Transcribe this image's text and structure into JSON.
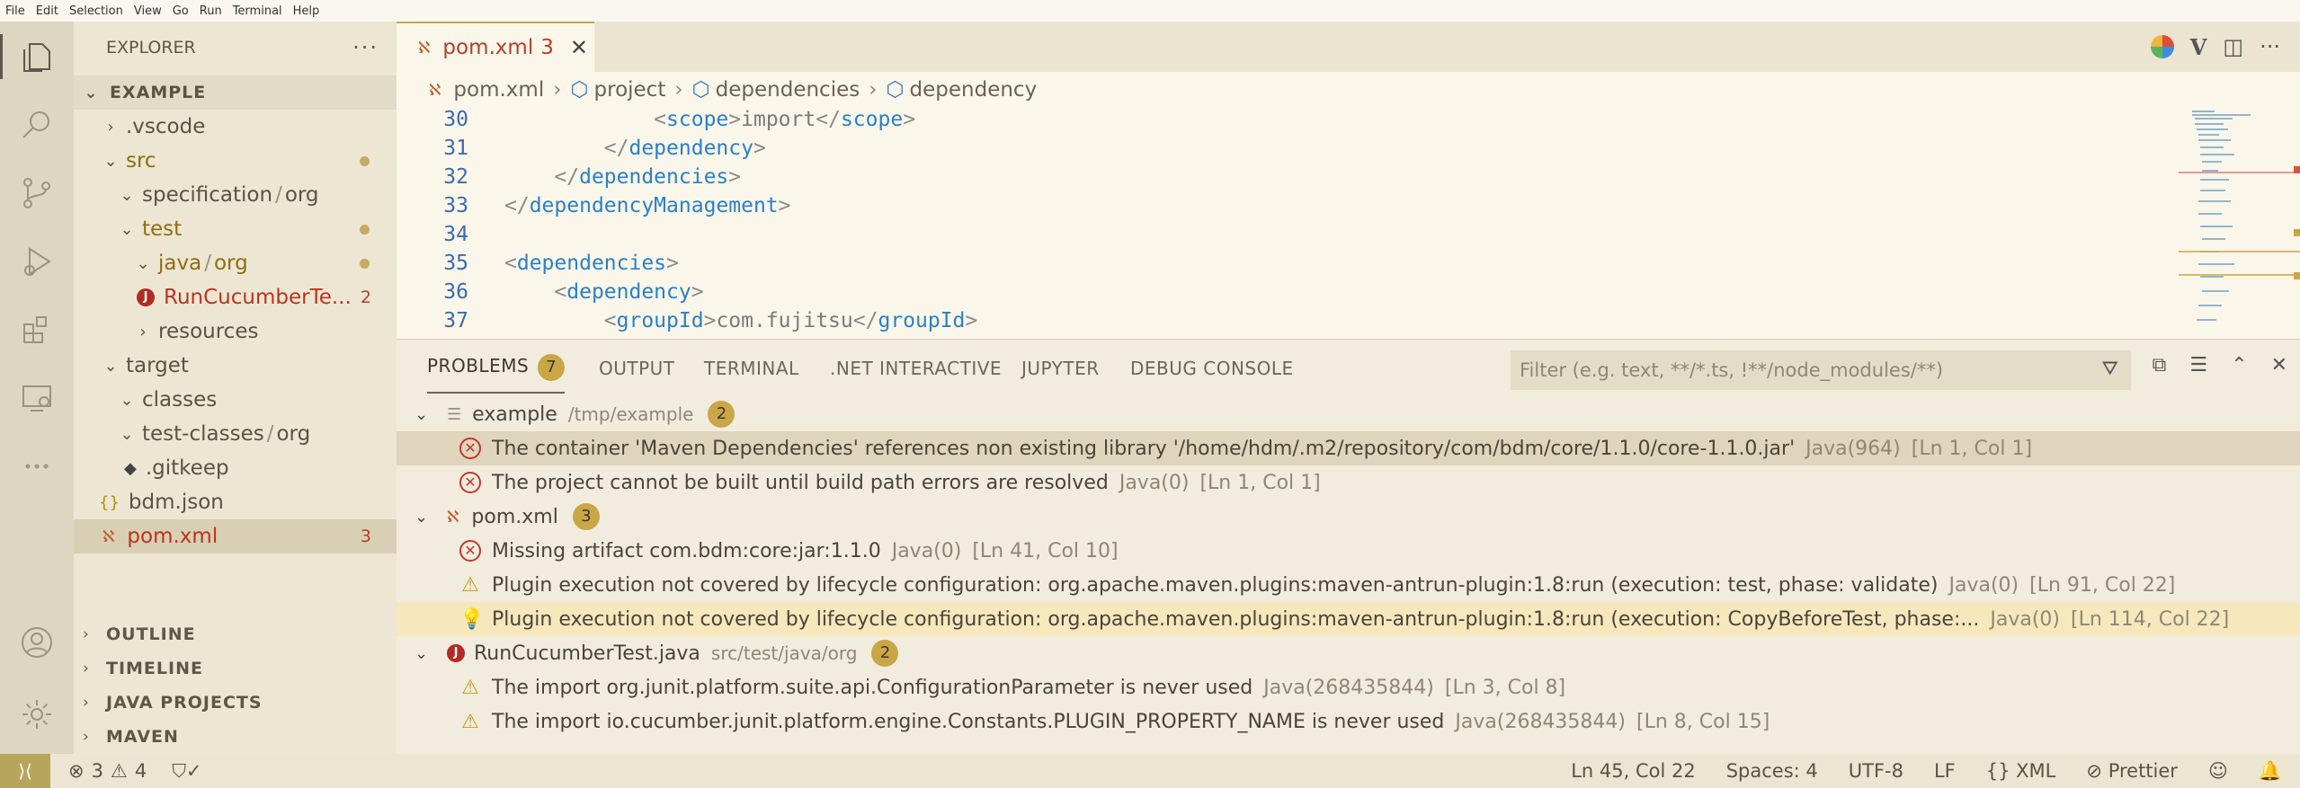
{
  "menu": [
    "File",
    "Edit",
    "Selection",
    "View",
    "Go",
    "Run",
    "Terminal",
    "Help"
  ],
  "explorer": {
    "title": "EXPLORER",
    "more": "···",
    "root": "EXAMPLE",
    "items": [
      {
        "label": ".vscode",
        "chev": "›",
        "indent": 1
      },
      {
        "label": "src",
        "chev": "⌄",
        "indent": 1
      },
      {
        "label": "specification",
        "label2": "org",
        "chev": "⌄",
        "indent": 2
      },
      {
        "label": "test",
        "chev": "⌄",
        "indent": 2
      },
      {
        "label": "java",
        "label2": "org",
        "chev": "⌄",
        "indent": 3
      },
      {
        "label": "RunCucumberTe...",
        "badge": "2",
        "indent": 3
      },
      {
        "label": "resources",
        "chev": "›",
        "indent": 3
      },
      {
        "label": "target",
        "chev": "⌄",
        "indent": 1
      },
      {
        "label": "classes",
        "chev": "⌄",
        "indent": 2
      },
      {
        "label": "test-classes",
        "label2": "org",
        "chev": "⌄",
        "indent": 2
      },
      {
        "label": ".gitkeep",
        "indent": 2
      },
      {
        "label": "bdm.json",
        "indent": 1
      },
      {
        "label": "pom.xml",
        "badge": "3",
        "indent": 1
      }
    ],
    "sections": [
      "OUTLINE",
      "TIMELINE",
      "JAVA PROJECTS",
      "MAVEN"
    ]
  },
  "editor": {
    "tab": {
      "label": "pom.xml",
      "count": "3"
    },
    "breadcrumb": [
      "pom.xml",
      "project",
      "dependencies",
      "dependency"
    ],
    "lines": [
      {
        "n": "30",
        "text": "            <scope>import</scope>"
      },
      {
        "n": "31",
        "text": "        </dependency>"
      },
      {
        "n": "32",
        "text": "    </dependencies>"
      },
      {
        "n": "33",
        "text": "</dependencyManagement>"
      },
      {
        "n": "34",
        "text": ""
      },
      {
        "n": "35",
        "text": "<dependencies>"
      },
      {
        "n": "36",
        "text": "    <dependency>"
      },
      {
        "n": "37",
        "text": "        <groupId>com.fujitsu</groupId>"
      }
    ]
  },
  "panel": {
    "tabs": [
      "PROBLEMS",
      "OUTPUT",
      "TERMINAL",
      ".NET INTERACTIVE",
      "JUPYTER",
      "DEBUG CONSOLE"
    ],
    "problems_count": "7",
    "filter_placeholder": "Filter (e.g. text, **/*.ts, !**/node_modules/**)",
    "groups": [
      {
        "name": "example",
        "path": "/tmp/example",
        "count": "2"
      },
      {
        "name": "pom.xml",
        "path": "",
        "count": "3"
      },
      {
        "name": "RunCucumberTest.java",
        "path": "src/test/java/org",
        "count": "2"
      }
    ],
    "problems": [
      {
        "msg": "The container 'Maven Dependencies' references non existing library '/home/hdm/.m2/repository/com/bdm/core/1.1.0/core-1.1.0.jar'",
        "src": "Java(964)",
        "loc": "[Ln 1, Col 1]"
      },
      {
        "msg": "The project cannot be built until build path errors are resolved",
        "src": "Java(0)",
        "loc": "[Ln 1, Col 1]"
      },
      {
        "msg": "Missing artifact com.bdm:core:jar:1.1.0",
        "src": "Java(0)",
        "loc": "[Ln 41, Col 10]"
      },
      {
        "msg": "Plugin execution not covered by lifecycle configuration: org.apache.maven.plugins:maven-antrun-plugin:1.8:run (execution: test, phase: validate)",
        "src": "Java(0)",
        "loc": "[Ln 91, Col 22]"
      },
      {
        "msg": "Plugin execution not covered by lifecycle configuration: org.apache.maven.plugins:maven-antrun-plugin:1.8:run (execution: CopyBeforeTest, phase:...",
        "src": "Java(0)",
        "loc": "[Ln 114, Col 22]"
      },
      {
        "msg": "The import org.junit.platform.suite.api.ConfigurationParameter is never used",
        "src": "Java(268435844)",
        "loc": "[Ln 3, Col 8]"
      },
      {
        "msg": "The import io.cucumber.junit.platform.engine.Constants.PLUGIN_PROPERTY_NAME is never used",
        "src": "Java(268435844)",
        "loc": "[Ln 8, Col 15]"
      }
    ]
  },
  "status": {
    "errors": "3",
    "warnings": "4",
    "position": "Ln 45, Col 22",
    "spaces": "Spaces: 4",
    "encoding": "UTF-8",
    "eol": "LF",
    "lang": "XML",
    "prettier": "Prettier"
  }
}
